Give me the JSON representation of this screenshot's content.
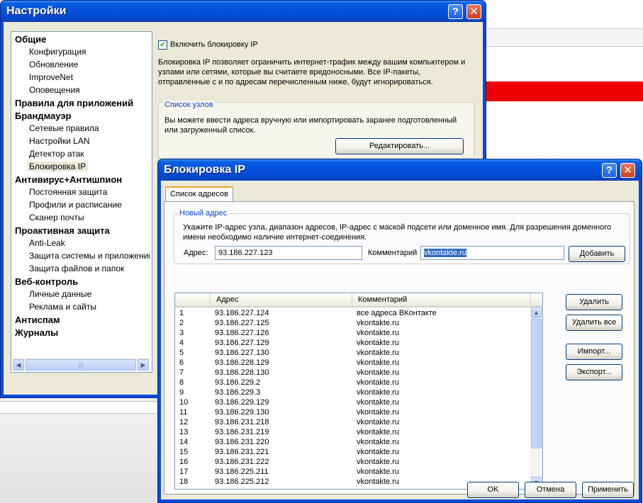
{
  "settings": {
    "title": "Настройки",
    "help_btn": "?",
    "close_btn": "✕",
    "tree": {
      "cat_general": "Общие",
      "configuration": "Конфигурация",
      "update": "Обновление",
      "improvenet": "ImproveNet",
      "notifications": "Оповещения",
      "cat_app_rules": "Правила для приложений",
      "cat_firewall": "Брандмауэр",
      "network_rules": "Сетевые правила",
      "lan_settings": "Настройки LAN",
      "attack_detector": "Детектор атак",
      "ip_blocking": "Блокировка IP",
      "cat_antivirus": "Антивирус+Антишпион",
      "realtime_protection": "Постоянная защита",
      "profiles_schedule": "Профили и расписание",
      "mail_scanner": "Сканер почты",
      "cat_proactive": "Проактивная защита",
      "anti_leak": "Anti-Leak",
      "system_protection": "Защита системы и приложений",
      "file_protection": "Защита файлов и папок",
      "cat_web": "Веб-контроль",
      "personal_data": "Личные данные",
      "ads_sites": "Реклама и сайты",
      "cat_antispam": "Антиспам",
      "cat_logs": "Журналы"
    },
    "panel": {
      "enable_checkbox_label": "Включить блокировку IP",
      "description": "Блокировка IP позволяет ограничить интернет-трафик между вашим компьютером и узлами или сетями, которые вы считаете вредоносными. Все IP-пакеты, отправленные с и по адресам перечисленным ниже, будут игнорироваться.",
      "host_list_legend": "Список узлов",
      "host_list_text": "Вы можете ввести адреса вручную или импортировать заранее подготовленный или загруженный список.",
      "edit_button": "Редактировать..."
    }
  },
  "ipdlg": {
    "title": "Блокировка IP",
    "help_btn": "?",
    "close_btn": "✕",
    "tab_label": "Список адресов",
    "new_address_legend": "Новый адрес",
    "instruction": "Укажите IP-адрес узла, диапазон адресов, IP-адрес с маской подсети или доменное имя. Для разрешения доменного имени необходимо наличие интернет-соединения.",
    "address_label": "Адрес:",
    "address_value": "93.186.227.123",
    "comment_label": "Комментарий",
    "comment_value": "vkontakte.ru",
    "add_button": "Добавить",
    "columns": [
      "Адрес",
      "Комментарий"
    ],
    "rows": [
      {
        "n": "1",
        "addr": "93.186.227.124",
        "comment": "все адреса ВКонтакте"
      },
      {
        "n": "2",
        "addr": "93.186.227.125",
        "comment": "vkontakte.ru"
      },
      {
        "n": "3",
        "addr": "93.186.227.126",
        "comment": "vkontakte.ru"
      },
      {
        "n": "4",
        "addr": "93.186.227.129",
        "comment": "vkontakte.ru"
      },
      {
        "n": "5",
        "addr": "93.186.227.130",
        "comment": "vkontakte.ru"
      },
      {
        "n": "6",
        "addr": "93.186.228.129",
        "comment": "vkontakte.ru"
      },
      {
        "n": "7",
        "addr": "93.186.228.130",
        "comment": "vkontakte.ru"
      },
      {
        "n": "8",
        "addr": "93.186.229.2",
        "comment": "vkontakte.ru"
      },
      {
        "n": "9",
        "addr": "93.186.229.3",
        "comment": "vkontakte.ru"
      },
      {
        "n": "10",
        "addr": "93.186.229.129",
        "comment": "vkontakte.ru"
      },
      {
        "n": "11",
        "addr": "93.186.229.130",
        "comment": "vkontakte.ru"
      },
      {
        "n": "12",
        "addr": "93.186.231.218",
        "comment": "vkontakte.ru"
      },
      {
        "n": "13",
        "addr": "93.186.231.219",
        "comment": "vkontakte.ru"
      },
      {
        "n": "14",
        "addr": "93.186.231.220",
        "comment": "vkontakte.ru"
      },
      {
        "n": "15",
        "addr": "93.186.231.221",
        "comment": "vkontakte.ru"
      },
      {
        "n": "16",
        "addr": "93.186.231.222",
        "comment": "vkontakte.ru"
      },
      {
        "n": "17",
        "addr": "93.186.225.211",
        "comment": "vkontakte.ru"
      },
      {
        "n": "18",
        "addr": "93.186.225.212",
        "comment": "vkontakte.ru"
      }
    ],
    "delete_button": "Удалить",
    "delete_all_button": "Удалить все",
    "import_button": "Импорт...",
    "export_button": "Экспорт...",
    "ok_button": "OK",
    "cancel_button": "Отмена",
    "apply_button": "Применить"
  },
  "icons": {
    "scroll_left": "arrow-left-icon",
    "scroll_right": "arrow-right-icon",
    "scroll_up": "arrow-up-icon",
    "scroll_down": "arrow-down-icon"
  },
  "colors": {
    "titlebar": "#0350dd",
    "dialog_bg": "#ece9d8",
    "selection": "#316ac5",
    "accent_red": "#ee0000"
  }
}
